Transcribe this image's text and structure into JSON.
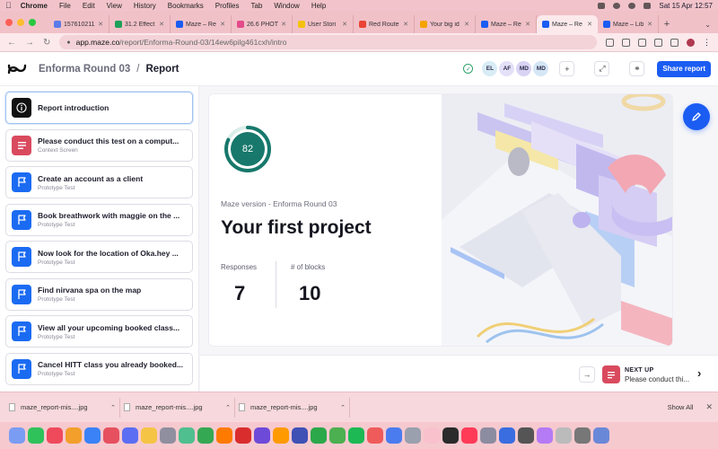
{
  "menubar": {
    "app_name": "Chrome",
    "items": [
      "File",
      "Edit",
      "View",
      "History",
      "Bookmarks",
      "Profiles",
      "Tab",
      "Window",
      "Help"
    ],
    "clock": "Sat 15 Apr  12:57"
  },
  "tabs": [
    {
      "label": "157610211",
      "color": "#5a7be8",
      "active": false
    },
    {
      "label": "31.2 Effect",
      "color": "#1ea05a",
      "active": false
    },
    {
      "label": "Maze – Re",
      "color": "#1b5cf2",
      "active": false
    },
    {
      "label": "26.6 PHOT",
      "color": "#e44b8a",
      "active": false
    },
    {
      "label": "User Stori",
      "color": "#f4c20d",
      "active": false
    },
    {
      "label": "Red Route",
      "color": "#ea4335",
      "active": false
    },
    {
      "label": "Your big id",
      "color": "#f4a300",
      "active": false
    },
    {
      "label": "Maze – Re",
      "color": "#1b5cf2",
      "active": false
    },
    {
      "label": "Maze – Re",
      "color": "#1b5cf2",
      "active": true
    },
    {
      "label": "Maze – Lib",
      "color": "#1b5cf2",
      "active": false
    }
  ],
  "address": {
    "host": "app.maze.co",
    "path": "/report/Enforma-Round-03/14ew6pilg461cxh/intro"
  },
  "header": {
    "project": "Enforma Round 03",
    "separator": "/",
    "page": "Report",
    "avatars": [
      "EL",
      "AF",
      "MD",
      "MD"
    ],
    "share_label": "Share report"
  },
  "blocks": [
    {
      "title": "Report introduction",
      "subtitle": "",
      "type": "intro",
      "active": true
    },
    {
      "title": "Please conduct this test on a comput...",
      "subtitle": "Context Screen",
      "type": "context",
      "active": false
    },
    {
      "title": "Create an account as a client",
      "subtitle": "Prototype Test",
      "type": "proto",
      "active": false
    },
    {
      "title": "Book breathwork with maggie on the ...",
      "subtitle": "Prototype Test",
      "type": "proto",
      "active": false
    },
    {
      "title": "Now look for the location of Oka.hey ...",
      "subtitle": "Prototype Test",
      "type": "proto",
      "active": false
    },
    {
      "title": "Find nirvana spa on the map",
      "subtitle": "Prototype Test",
      "type": "proto",
      "active": false
    },
    {
      "title": "View all your upcoming booked class...",
      "subtitle": "Prototype Test",
      "type": "proto",
      "active": false
    },
    {
      "title": "Cancel HITT class you already booked...",
      "subtitle": "Prototype Test",
      "type": "proto",
      "active": false
    }
  ],
  "report": {
    "score": "82",
    "score_fraction": 0.82,
    "version": "Maze version - Enforma Round 03",
    "title": "Your first project",
    "responses_label": "Responses",
    "responses_value": "7",
    "blocks_label": "# of blocks",
    "blocks_value": "10"
  },
  "next_up": {
    "label": "NEXT UP",
    "text": "Please conduct thi..."
  },
  "downloads": {
    "items": [
      "maze_report-mis....jpg",
      "maze_report-mis....jpg",
      "maze_report-mis....jpg"
    ],
    "show_all": "Show All"
  },
  "colors": {
    "accent": "#1b5cf2",
    "score_teal": "#17786b",
    "context_red": "#d94a5e"
  }
}
